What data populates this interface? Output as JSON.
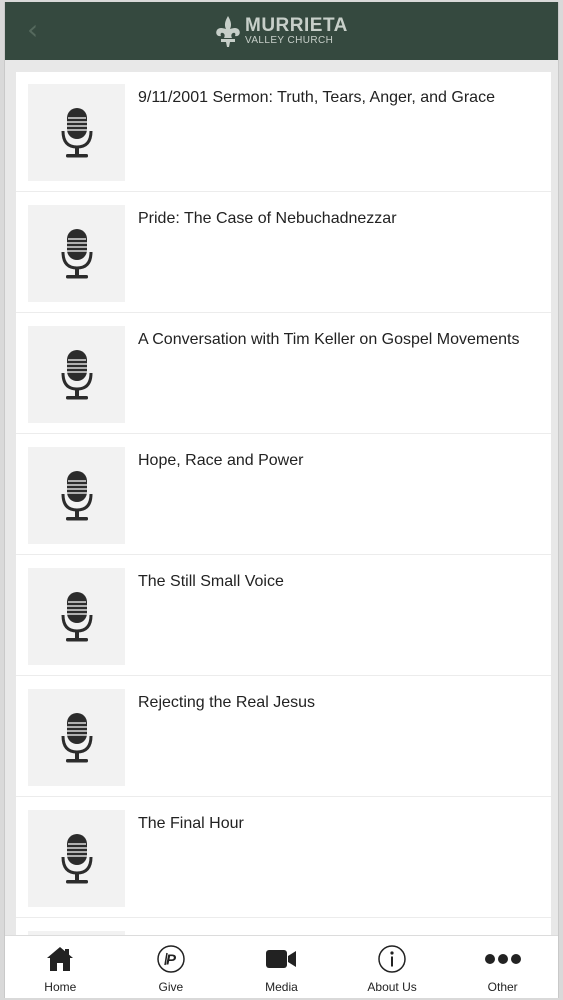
{
  "header": {
    "back_icon": "chevron-left-icon",
    "logo_main": "MURRIETA",
    "logo_sub": "VALLEY CHURCH",
    "background": "#35493f"
  },
  "media_list": {
    "thumbnail_icon": "microphone-icon",
    "items": [
      {
        "title": "9/11/2001 Sermon: Truth, Tears, Anger, and Grace"
      },
      {
        "title": "Pride: The Case of Nebuchadnezzar"
      },
      {
        "title": "A Conversation with Tim Keller on Gospel Movements"
      },
      {
        "title": "Hope, Race and Power"
      },
      {
        "title": "The Still Small Voice"
      },
      {
        "title": "Rejecting the Real Jesus"
      },
      {
        "title": "The Final Hour"
      },
      {
        "title": ""
      }
    ]
  },
  "tabbar": {
    "tabs": [
      {
        "label": "Home",
        "icon": "home-icon"
      },
      {
        "label": "Give",
        "icon": "give-icon"
      },
      {
        "label": "Media",
        "icon": "video-camera-icon"
      },
      {
        "label": "About Us",
        "icon": "info-icon"
      },
      {
        "label": "Other",
        "icon": "more-dots-icon"
      }
    ]
  }
}
